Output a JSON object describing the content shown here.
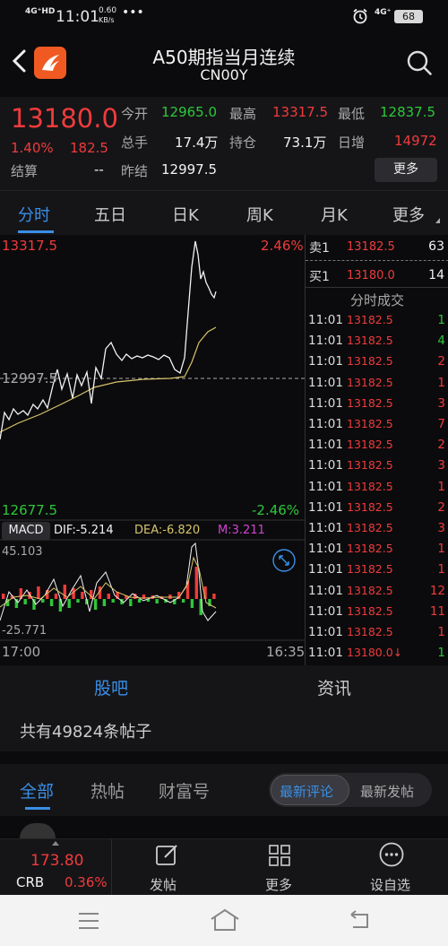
{
  "status": {
    "network": "4G⁺HD",
    "time": "11:01",
    "speed": "0.60",
    "speed_unit": "KB/s",
    "dots": "•••",
    "net2": "4G⁺",
    "battery": "68"
  },
  "header": {
    "title": "A50期指当月连续",
    "code": "CN00Y"
  },
  "quote": {
    "price": "13180.0",
    "pct": "1.40%",
    "chg": "182.5",
    "settle_label": "结算",
    "settle": "--",
    "open_label": "今开",
    "open": "12965.0",
    "high_label": "最高",
    "high": "13317.5",
    "low_label": "最低",
    "low": "12837.5",
    "vol_label": "总手",
    "vol": "17.4万",
    "oi_label": "持仓",
    "oi": "73.1万",
    "daily_label": "日增",
    "daily": "14972",
    "prev_label": "昨结",
    "prev": "12997.5",
    "more": "更多"
  },
  "tabs": [
    "分时",
    "五日",
    "日K",
    "周K",
    "月K",
    "更多"
  ],
  "chart": {
    "ymax": "13317.5",
    "ymin": "12677.5",
    "pmax": "2.46%",
    "pmin": "-2.46%",
    "base": "12997.5",
    "macd_label": "MACD",
    "dif": "DIF:-5.214",
    "dea": "DEA:-6.820",
    "m": "M:3.211",
    "macd_max": "45.103",
    "macd_min": "-25.771",
    "t_start": "17:00",
    "t_end": "16:35"
  },
  "book": {
    "sell_label": "卖1",
    "sell_price": "13182.5",
    "sell_qty": "63",
    "buy_label": "买1",
    "buy_price": "13180.0",
    "buy_qty": "14",
    "trades_title": "分时成交"
  },
  "trades": [
    {
      "t": "11:01",
      "p": "13182.5",
      "q": "1",
      "c": "green"
    },
    {
      "t": "11:01",
      "p": "13182.5",
      "q": "4",
      "c": "green"
    },
    {
      "t": "11:01",
      "p": "13182.5",
      "q": "2",
      "c": "red"
    },
    {
      "t": "11:01",
      "p": "13182.5",
      "q": "1",
      "c": "red"
    },
    {
      "t": "11:01",
      "p": "13182.5",
      "q": "3",
      "c": "red"
    },
    {
      "t": "11:01",
      "p": "13182.5",
      "q": "7",
      "c": "red"
    },
    {
      "t": "11:01",
      "p": "13182.5",
      "q": "2",
      "c": "red"
    },
    {
      "t": "11:01",
      "p": "13182.5",
      "q": "3",
      "c": "red"
    },
    {
      "t": "11:01",
      "p": "13182.5",
      "q": "1",
      "c": "red"
    },
    {
      "t": "11:01",
      "p": "13182.5",
      "q": "2",
      "c": "red"
    },
    {
      "t": "11:01",
      "p": "13182.5",
      "q": "3",
      "c": "red"
    },
    {
      "t": "11:01",
      "p": "13182.5",
      "q": "1",
      "c": "red"
    },
    {
      "t": "11:01",
      "p": "13182.5",
      "q": "1",
      "c": "red"
    },
    {
      "t": "11:01",
      "p": "13182.5",
      "q": "12",
      "c": "red"
    },
    {
      "t": "11:01",
      "p": "13182.5",
      "q": "11",
      "c": "red"
    },
    {
      "t": "11:01",
      "p": "13182.5",
      "q": "1",
      "c": "red"
    },
    {
      "t": "11:01",
      "p": "13180.0↓",
      "q": "1",
      "c": "green"
    }
  ],
  "guba": {
    "tab1": "股吧",
    "tab2": "资讯",
    "posts": "共有49824条帖子"
  },
  "subtabs": {
    "all": "全部",
    "hot": "热帖",
    "wealth": "财富号",
    "latest_comment": "最新评论",
    "latest_post": "最新发帖"
  },
  "bottom": {
    "ticker_price": "173.80",
    "ticker_name": "CRB",
    "ticker_pct": "0.36%",
    "post": "发帖",
    "more": "更多",
    "watch": "设自选"
  },
  "colors": {
    "red": "#f03b3b",
    "green": "#2ec73a",
    "accent": "#3a8ee6",
    "bg": "#0b0b0d"
  }
}
